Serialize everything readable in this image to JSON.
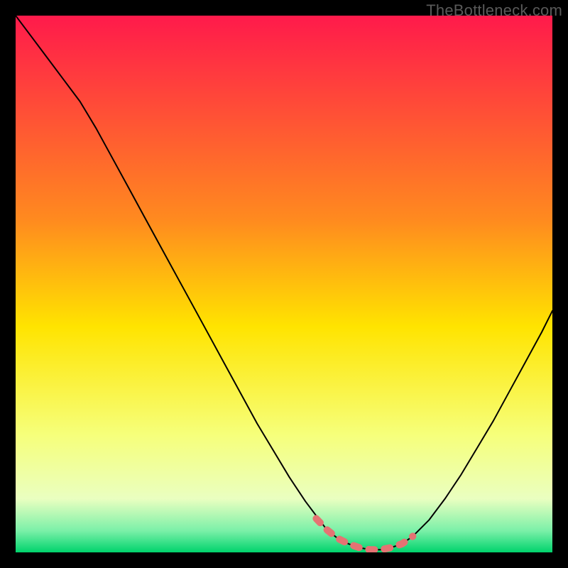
{
  "watermark": "TheBottleneck.com",
  "colors": {
    "black": "#000000",
    "curve": "#000000",
    "highlight": "#e57373",
    "grad_top": "#ff1a4b",
    "grad_upper_mid": "#ffb000",
    "grad_mid": "#ffe400",
    "grad_lower_mid": "#f6ff7a",
    "grad_low": "#c8ffb0",
    "grad_bottom": "#00d36c"
  },
  "chart_data": {
    "type": "line",
    "title": "",
    "xlabel": "",
    "ylabel": "",
    "xlim": [
      0,
      100
    ],
    "ylim": [
      0,
      100
    ],
    "grid": false,
    "x": [
      0,
      3,
      6,
      9,
      12,
      15,
      18,
      21,
      24,
      27,
      30,
      33,
      36,
      39,
      42,
      45,
      48,
      51,
      54,
      57,
      58,
      60,
      62,
      64,
      66,
      68,
      70,
      72,
      74,
      77,
      80,
      83,
      86,
      89,
      92,
      95,
      98,
      100
    ],
    "series": [
      {
        "name": "bottleneck-curve",
        "values": [
          100,
          96,
          92,
          88,
          84,
          79,
          73.5,
          68,
          62.5,
          57,
          51.5,
          46,
          40.5,
          35,
          29.5,
          24,
          19,
          14,
          9.5,
          5.5,
          4.2,
          2.6,
          1.6,
          0.9,
          0.5,
          0.5,
          0.9,
          1.6,
          3.0,
          6.0,
          10.0,
          14.5,
          19.5,
          24.5,
          30,
          35.5,
          41,
          45
        ]
      }
    ],
    "highlight_segment": {
      "x": [
        56,
        58,
        60,
        62,
        64,
        66,
        68,
        70,
        72,
        74
      ],
      "y": [
        6.3,
        4.2,
        2.6,
        1.6,
        0.9,
        0.5,
        0.5,
        0.9,
        1.6,
        3.0
      ]
    }
  }
}
